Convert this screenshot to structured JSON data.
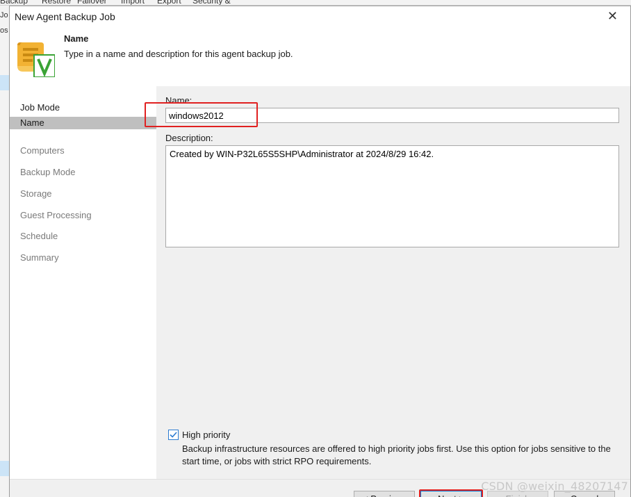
{
  "background": {
    "ribbon": [
      "Backup",
      "Restore",
      "Failover",
      "Import",
      "Export",
      "Security &"
    ],
    "left_labels": [
      "Jo",
      "os"
    ]
  },
  "dialog": {
    "title": "New Agent Backup Job",
    "close_glyph": "✕"
  },
  "header": {
    "title": "Name",
    "subtitle": "Type in a name and description for this agent backup job.",
    "icon": "scroll-v-icon"
  },
  "nav": {
    "items": [
      {
        "label": "Job Mode",
        "state": "done"
      },
      {
        "label": "Name",
        "state": "active"
      },
      {
        "label": "Computers",
        "state": "pending"
      },
      {
        "label": "Backup Mode",
        "state": "pending"
      },
      {
        "label": "Storage",
        "state": "pending"
      },
      {
        "label": "Guest Processing",
        "state": "pending"
      },
      {
        "label": "Schedule",
        "state": "pending"
      },
      {
        "label": "Summary",
        "state": "pending"
      }
    ]
  },
  "form": {
    "name_label": "Name:",
    "name_value": "windows2012",
    "description_label": "Description:",
    "description_value": "Created by WIN-P32L65S5SHP\\Administrator at 2024/8/29 16:42.",
    "high_priority_label": "High priority",
    "high_priority_checked": true,
    "high_priority_desc": "Backup infrastructure resources are offered to high priority jobs first. Use this option for jobs sensitive to the start time, or jobs with strict RPO requirements."
  },
  "footer": {
    "previous": "< Previous",
    "next": "Next >",
    "finish": "Finish",
    "cancel": "Cancel"
  },
  "watermark": "CSDN @weixin_48207147",
  "colors": {
    "highlight_red": "#e02020",
    "active_nav": "#bfbfbf",
    "checkbox_blue": "#2b7bd1",
    "icon_gold": "#f2b233",
    "icon_green": "#3aa335"
  }
}
